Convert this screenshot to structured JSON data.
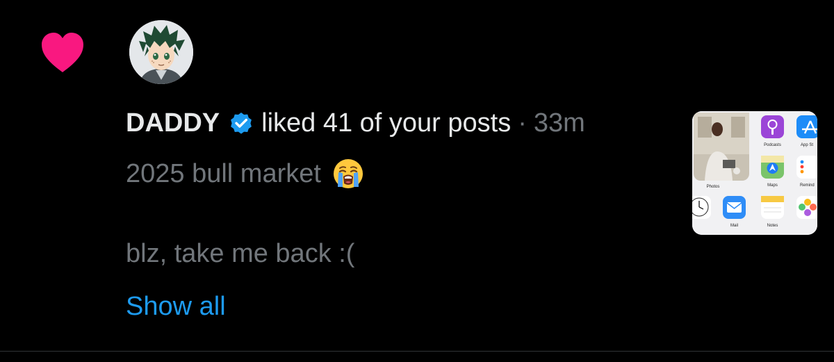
{
  "notification": {
    "type_icon": "heart-icon",
    "avatar_icon": "avatar-anime-character",
    "user_name": "DADDY",
    "verified_icon": "verified-badge-icon",
    "action_text": "liked 41 of your posts",
    "separator": "·",
    "time": "33m",
    "post_line_1": "2025 bull market",
    "post_emoji": "loudly-crying-face-emoji",
    "post_line_2": "blz, take me back :(",
    "show_all": "Show all"
  },
  "thumbnail": {
    "labels": {
      "podcasts": "Podcasts",
      "app_store": "App St",
      "photos": "Photos",
      "maps": "Maps",
      "reminders": "Remind",
      "mail": "Mail",
      "notes": "Notes"
    }
  },
  "colors": {
    "background": "#000000",
    "heart": "#f91880",
    "verified": "#1d9bf0",
    "link": "#1d9bf0",
    "primary_text": "#e7e9ea",
    "secondary_text": "#71767b"
  }
}
